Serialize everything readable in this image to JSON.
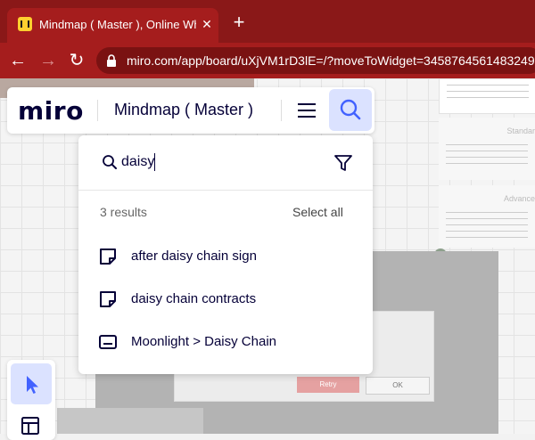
{
  "browser": {
    "tab_title": "Mindmap ( Master ), Online Whit",
    "tab_close": "✕",
    "new_tab": "+",
    "back": "←",
    "forward": "→",
    "reload": "↻",
    "url": "miro.com/app/board/uXjVM1rD3lE=/?moveToWidget=3458764561483249"
  },
  "miro": {
    "logo": "miro",
    "board_title": "Mindmap ( Master )"
  },
  "search": {
    "query": "daisy",
    "results_count": "3 results",
    "select_all": "Select all",
    "results": [
      {
        "label": "after daisy chain sign",
        "icon": "sticky-note-icon"
      },
      {
        "label": "daisy chain contracts",
        "icon": "sticky-note-icon"
      },
      {
        "label": "Moonlight > Daisy Chain",
        "icon": "card-icon"
      }
    ]
  },
  "canvas": {
    "dialog_retry": "Retry",
    "dialog_ok": "OK",
    "side_headers": [
      "Standar",
      "Advance"
    ]
  },
  "colors": {
    "chrome_dark": "#8a1818",
    "chrome": "#a51d1d",
    "accent": "#4262ff",
    "accent_bg": "#dbe2ff",
    "ink": "#050038"
  }
}
